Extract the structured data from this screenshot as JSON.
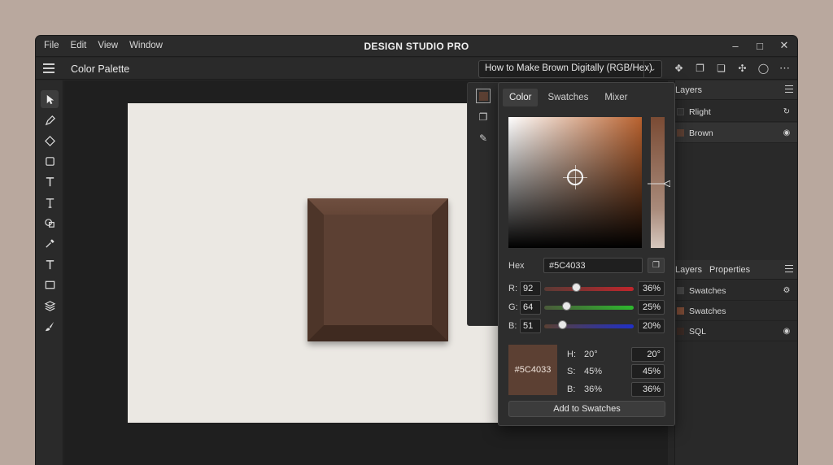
{
  "menu": [
    "File",
    "Edit",
    "View",
    "Window"
  ],
  "app_title": "DESIGN STUDIO PRO",
  "topbar": {
    "panel_title": "Color Palette",
    "tutorial_select": "How to Make Brown Digitally (RGB/Hex)"
  },
  "picker": {
    "tabs": [
      "Color",
      "Swatches",
      "Mixer"
    ],
    "hex_label": "Hex",
    "hex_value": "#5C4033",
    "rgb": [
      {
        "channel": "R:",
        "value": "92",
        "percent": "36%",
        "level": 0.36
      },
      {
        "channel": "G:",
        "value": "64",
        "percent": "25%",
        "level": 0.25
      },
      {
        "channel": "B:",
        "value": "51",
        "percent": "20%",
        "level": 0.2
      }
    ],
    "preview_label": "#5C4033",
    "hsb": [
      {
        "key": "H:",
        "value": "20°",
        "box": "20°"
      },
      {
        "key": "S:",
        "value": "45%",
        "box": "45%"
      },
      {
        "key": "B:",
        "value": "36%",
        "box": "36%"
      }
    ],
    "add_button": "Add to Swatches"
  },
  "layers_panel": {
    "title": "Layers",
    "rows": [
      {
        "label": "Rlight",
        "swatch": "#333333",
        "icon": "refresh-icon"
      },
      {
        "label": "Brown",
        "swatch": "#5c4033",
        "icon": "eye-icon"
      }
    ]
  },
  "lower_panel": {
    "tabs": [
      "Layers",
      "Properties"
    ],
    "rows": [
      {
        "label": "Swatches",
        "swatch": "#444444",
        "icon": "settings-icon"
      },
      {
        "label": "Swatches",
        "swatch": "#7a4a35",
        "icon": ""
      },
      {
        "label": "SQL",
        "swatch": "#3a2a24",
        "icon": "eye-icon"
      }
    ]
  },
  "colors": {
    "brown": "#5C4033",
    "artboard": "#ebe8e3",
    "ui_dark": "#262626"
  }
}
